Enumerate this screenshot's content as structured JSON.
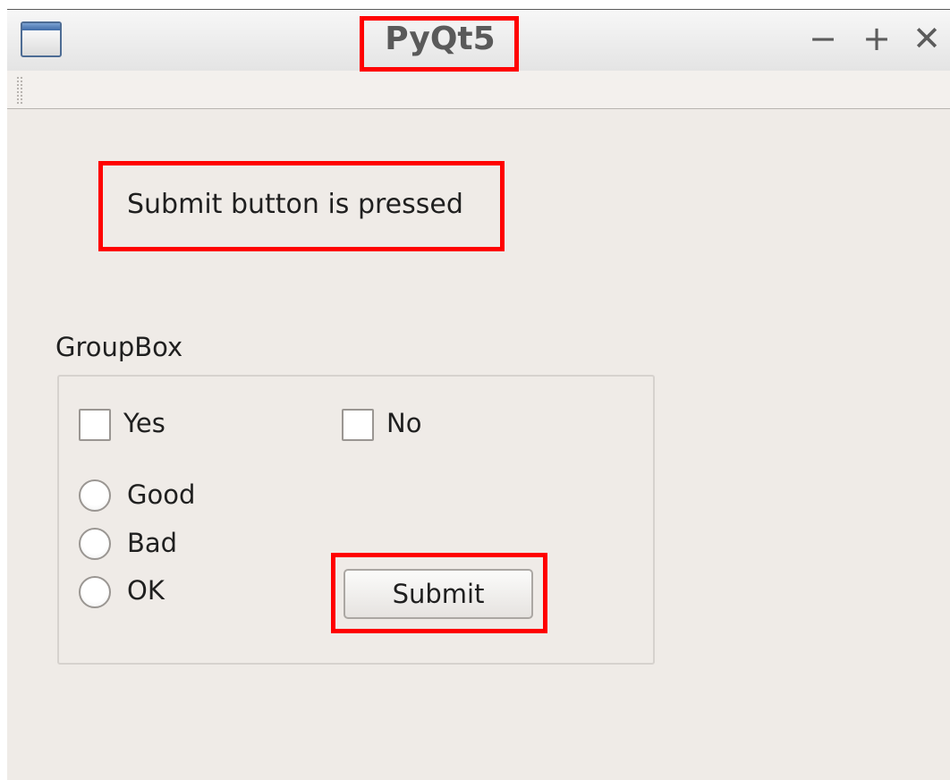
{
  "window": {
    "title": "PyQt5",
    "controls": {
      "minimize": "−",
      "maximize": "+",
      "close": "✕"
    },
    "app_icon": "window-app-icon"
  },
  "status": {
    "text": "Submit button is pressed"
  },
  "groupbox": {
    "title": "GroupBox",
    "checkboxes": [
      {
        "label": "Yes",
        "checked": false
      },
      {
        "label": "No",
        "checked": false
      }
    ],
    "radios": [
      {
        "label": "Good",
        "checked": false
      },
      {
        "label": "Bad",
        "checked": false
      },
      {
        "label": "OK",
        "checked": false
      }
    ],
    "submit_label": "Submit"
  },
  "colors": {
    "highlight": "#ff0000",
    "background": "#efebe7"
  }
}
